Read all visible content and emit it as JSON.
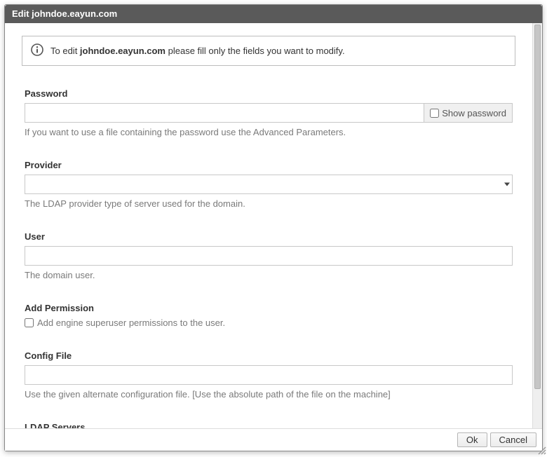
{
  "dialog": {
    "title_prefix": "Edit ",
    "title_domain": "johndoe.eayun.com"
  },
  "info": {
    "pre_text": "To edit ",
    "domain": "johndoe.eayun.com",
    "post_text": " please fill only the fields you want to modify."
  },
  "fields": {
    "password": {
      "label": "Password",
      "value": "",
      "show_label": "Show password",
      "show_checked": false,
      "help": "If you want to use a file containing the password use the Advanced Parameters."
    },
    "provider": {
      "label": "Provider",
      "value": "",
      "help": "The LDAP provider type of server used for the domain."
    },
    "user": {
      "label": "User",
      "value": "",
      "help": "The domain user."
    },
    "add_permission": {
      "label": "Add Permission",
      "checkbox_label": "Add engine superuser permissions to the user.",
      "checked": false
    },
    "config_file": {
      "label": "Config File",
      "value": "",
      "help": "Use the given alternate configuration file. [Use the absolute path of the file on the machine]"
    },
    "ldap_servers": {
      "label": "LDAP Servers"
    }
  },
  "buttons": {
    "ok": "Ok",
    "cancel": "Cancel"
  }
}
